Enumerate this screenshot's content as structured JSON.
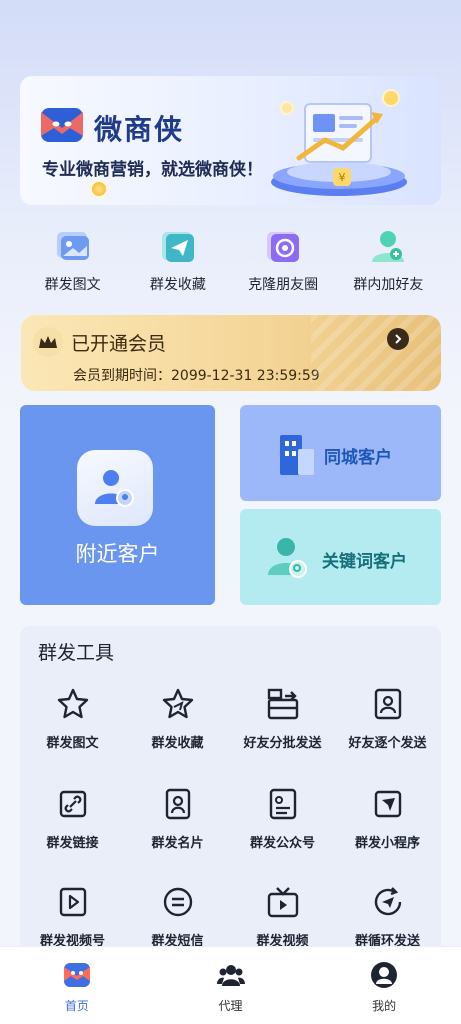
{
  "banner": {
    "brand_name": "微商侠",
    "slogan": "专业微商营销，就选微商侠！"
  },
  "quick_actions": [
    {
      "label": "群发图文",
      "icon": "image-text-icon"
    },
    {
      "label": "群发收藏",
      "icon": "favorite-send-icon"
    },
    {
      "label": "克隆朋友圈",
      "icon": "clone-moments-icon"
    },
    {
      "label": "群内加好友",
      "icon": "add-friend-icon"
    }
  ],
  "vip": {
    "title": "已开通会员",
    "expiry": "会员到期时间：2099-12-31 23:59:59"
  },
  "features": {
    "nearby": "附近客户",
    "city": "同城客户",
    "keyword": "关键词客户"
  },
  "tools": {
    "title": "群发工具",
    "items": [
      {
        "label": "群发图文",
        "icon": "star-icon"
      },
      {
        "label": "群发收藏",
        "icon": "star-send-icon"
      },
      {
        "label": "好友分批发送",
        "icon": "batch-send-icon"
      },
      {
        "label": "好友逐个发送",
        "icon": "contact-card-icon"
      },
      {
        "label": "群发链接",
        "icon": "link-icon"
      },
      {
        "label": "群发名片",
        "icon": "id-card-icon"
      },
      {
        "label": "群发公众号",
        "icon": "official-account-icon"
      },
      {
        "label": "群发小程序",
        "icon": "mini-program-icon"
      },
      {
        "label": "群发视频号",
        "icon": "video-channel-icon"
      },
      {
        "label": "群发短信",
        "icon": "sms-icon"
      },
      {
        "label": "群发视频",
        "icon": "tv-icon"
      },
      {
        "label": "群循环发送",
        "icon": "loop-send-icon"
      }
    ]
  },
  "bottom_nav": [
    {
      "label": "首页",
      "icon": "home-icon",
      "active": true
    },
    {
      "label": "代理",
      "icon": "agent-icon",
      "active": false
    },
    {
      "label": "我的",
      "icon": "profile-icon",
      "active": false
    }
  ],
  "colors": {
    "accent": "#3f6fe0",
    "nearby_card": "#6b96f0",
    "city_card": "#9cb8f8",
    "keyword_card": "#b3ebf0",
    "vip_gold": "#f4d597"
  }
}
